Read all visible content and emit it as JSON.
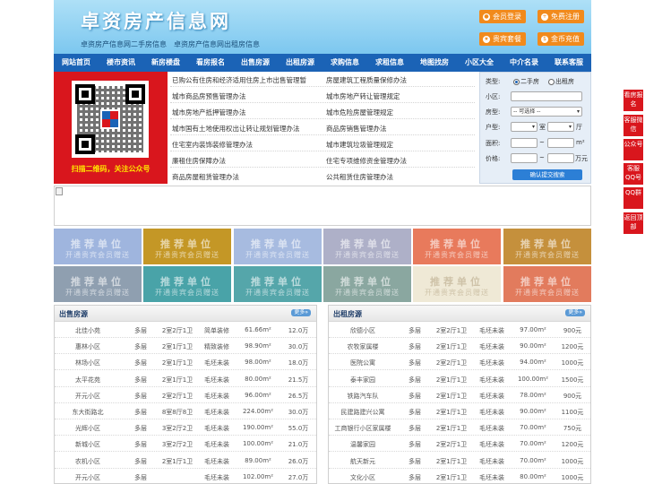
{
  "header": {
    "site_title": "卓资房产信息网",
    "sub_links": [
      "卓资房产信息网二手房信息",
      "卓资房产信息网出租房信息"
    ],
    "buttons": [
      {
        "label": "会员登录",
        "icon": "user-icon"
      },
      {
        "label": "免费注册",
        "icon": "register-icon"
      },
      {
        "label": "贵宾套餐",
        "icon": "vip-icon"
      },
      {
        "label": "金币充值",
        "icon": "coin-icon"
      }
    ]
  },
  "nav": [
    "网站首页",
    "楼市资讯",
    "新房楼盘",
    "看房报名",
    "出售房源",
    "出租房源",
    "求购信息",
    "求租信息",
    "地图找房",
    "小区大全",
    "中介名录",
    "联系客服"
  ],
  "qr": {
    "caption": "扫描二维码，关注公众号"
  },
  "laws": [
    "已购公有住房和经济适用住房上市出售管理暂",
    "房屋建筑工程质量保修办法",
    "城市商品房预售管理办法",
    "城市房地产转让管理规定",
    "城市房地产抵押管理办法",
    "城市危险房屋管理规定",
    "城市国有土地使用权出让转让规划管理办法",
    "商品房销售管理办法",
    "住宅室内装饰装修管理办法",
    "城市建筑垃圾管理规定",
    "廉租住房保障办法",
    "住宅专项维修资金管理办法",
    "商品房屋租赁管理办法",
    "公共租赁住房管理办法"
  ],
  "search": {
    "type_label": "类型:",
    "radio_sale": "二手房",
    "radio_rent": "出租房",
    "community_label": "小区:",
    "community_value": "",
    "housetype_label": "房型:",
    "housetype_value": "-- 可选择 --",
    "layout_label": "户型:",
    "shi_unit": "室",
    "ting_unit": "厅",
    "area_label": "面积:",
    "area_unit": "m²",
    "price_label": "价格:",
    "price_unit": "万元",
    "submit": "确认提交搜索"
  },
  "promo": {
    "line1": "推荐单位",
    "line2": "开通贵宾会员赠送",
    "colors": [
      "#9fb5de",
      "#c49726",
      "#a7bbe0",
      "#aeb0c8",
      "#e87a5c",
      "#c5903c",
      "#8f9fb0",
      "#49a3a8",
      "#55a6aa",
      "#8aa7a0",
      "#efe9d6",
      "#e27b5d"
    ]
  },
  "sale": {
    "title": "出售房源",
    "more": "更多»",
    "rows": [
      [
        "北佳小苑",
        "多层",
        "2室2厅1卫",
        "简单装修",
        "61.66m²",
        "12.0万"
      ],
      [
        "惠林小区",
        "多层",
        "2室1厅1卫",
        "精致装修",
        "98.90m²",
        "30.0万"
      ],
      [
        "林场小区",
        "多层",
        "2室1厅1卫",
        "毛坯未装",
        "98.00m²",
        "18.0万"
      ],
      [
        "太平花苑",
        "多层",
        "2室1厅1卫",
        "毛坯未装",
        "80.00m²",
        "21.5万"
      ],
      [
        "开元小区",
        "多层",
        "2室2厅1卫",
        "毛坯未装",
        "96.00m²",
        "26.5万"
      ],
      [
        "东大街路北",
        "多层",
        "8室8厅8卫",
        "毛坯未装",
        "224.00m²",
        "30.0万"
      ],
      [
        "光辉小区",
        "多层",
        "3室2厅2卫",
        "毛坯未装",
        "190.00m²",
        "55.0万"
      ],
      [
        "新城小区",
        "多层",
        "3室2厅2卫",
        "毛坯未装",
        "100.00m²",
        "21.0万"
      ],
      [
        "农机小区",
        "多层",
        "2室1厅1卫",
        "毛坯未装",
        "89.00m²",
        "26.0万"
      ],
      [
        "开元小区",
        "多层",
        "",
        "毛坯未装",
        "102.00m²",
        "27.0万"
      ]
    ]
  },
  "rent": {
    "title": "出租房源",
    "more": "更多»",
    "rows": [
      [
        "欣德小区",
        "多层",
        "2室2厅1卫",
        "毛坯未装",
        "97.00m²",
        "900元"
      ],
      [
        "农牧家属楼",
        "多层",
        "2室1厅1卫",
        "毛坯未装",
        "90.00m²",
        "1200元"
      ],
      [
        "医院公寓",
        "多层",
        "2室2厅1卫",
        "毛坯未装",
        "94.00m²",
        "1000元"
      ],
      [
        "泰丰家园",
        "多层",
        "2室1厅1卫",
        "毛坯未装",
        "100.00m²",
        "1500元"
      ],
      [
        "铁路汽车队",
        "多层",
        "2室1厅1卫",
        "毛坯未装",
        "78.00m²",
        "900元"
      ],
      [
        "民建路建兴公寓",
        "多层",
        "2室1厅1卫",
        "毛坯未装",
        "90.00m²",
        "1100元"
      ],
      [
        "工商银行小区家属楼",
        "多层",
        "2室1厅1卫",
        "毛坯未装",
        "70.00m²",
        "750元"
      ],
      [
        "温馨家园",
        "多层",
        "2室2厅1卫",
        "毛坯未装",
        "70.00m²",
        "1200元"
      ],
      [
        "航天新元",
        "多层",
        "2室1厅1卫",
        "毛坯未装",
        "70.00m²",
        "1000元"
      ],
      [
        "文化小区",
        "多层",
        "2室1厅1卫",
        "毛坯未装",
        "80.00m²",
        "1000元"
      ]
    ]
  },
  "float": [
    "看房报名",
    "客服微信",
    "公众号",
    "客服QQ号",
    "QQ群",
    "返回顶部"
  ]
}
